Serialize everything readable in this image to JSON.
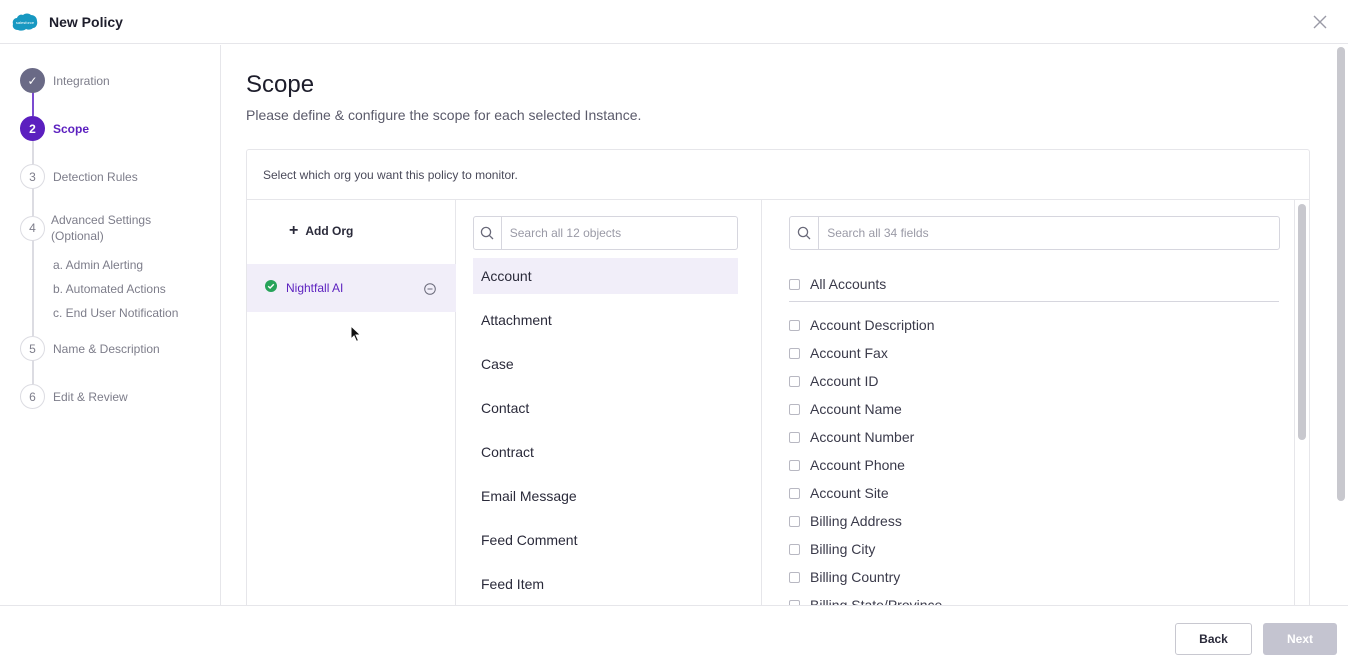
{
  "header": {
    "title": "New Policy",
    "logo_text": "salesforce"
  },
  "stepper": {
    "steps": [
      {
        "num": "✓",
        "label": "Integration"
      },
      {
        "num": "2",
        "label": "Scope"
      },
      {
        "num": "3",
        "label": "Detection Rules"
      },
      {
        "num": "4",
        "label": "Advanced Settings (Optional)"
      },
      {
        "num": "5",
        "label": "Name & Description"
      },
      {
        "num": "6",
        "label": "Edit & Review"
      }
    ],
    "substeps": [
      "a. Admin Alerting",
      "b. Automated Actions",
      "c. End User Notification"
    ]
  },
  "main": {
    "title": "Scope",
    "subtitle": "Please define & configure the scope for each selected Instance.",
    "card_heading": "Select which org you want this policy to monitor.",
    "add_org_label": "Add Org",
    "orgs": [
      {
        "name": "Nightfall AI"
      }
    ],
    "objects_search_placeholder": "Search all 12 objects",
    "objects": [
      "Account",
      "Attachment",
      "Case",
      "Contact",
      "Contract",
      "Email Message",
      "Feed Comment",
      "Feed Item"
    ],
    "fields_search_placeholder": "Search all 34 fields",
    "all_label": "All Accounts",
    "fields": [
      "Account Description",
      "Account Fax",
      "Account ID",
      "Account Name",
      "Account Number",
      "Account Phone",
      "Account Site",
      "Billing Address",
      "Billing City",
      "Billing Country",
      "Billing State/Province"
    ]
  },
  "footer": {
    "back_label": "Back",
    "next_label": "Next"
  },
  "colors": {
    "accent": "#5b1fbf",
    "success": "#27a35a",
    "selected_bg": "#f1eef9"
  }
}
